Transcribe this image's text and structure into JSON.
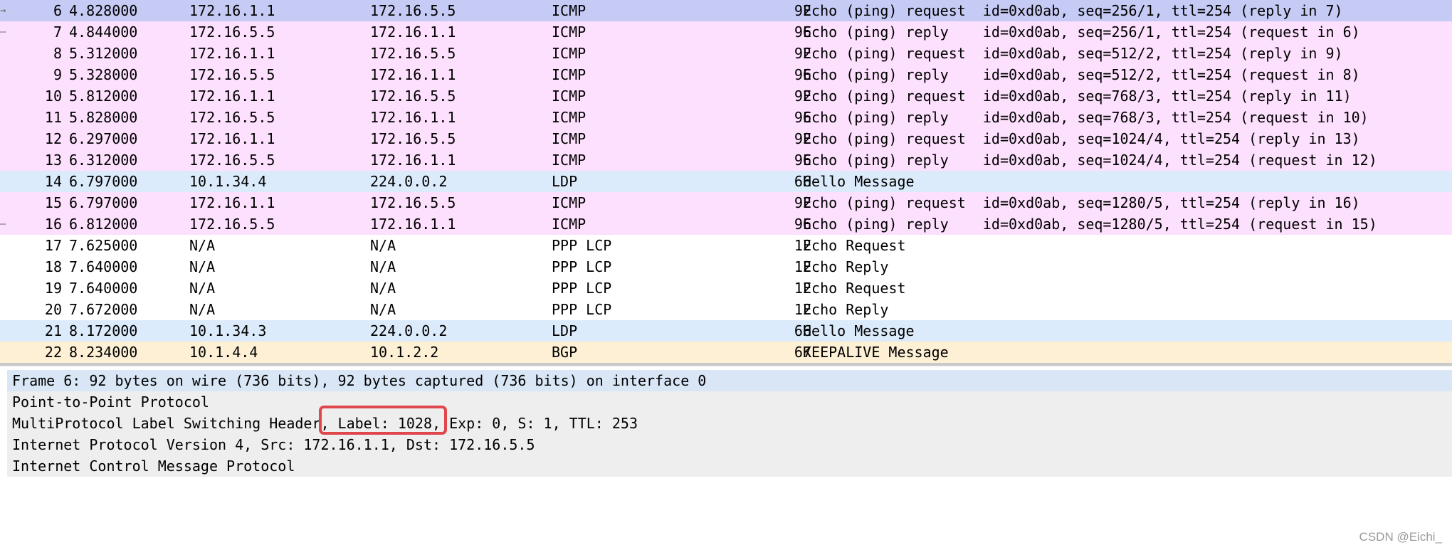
{
  "colors": {
    "selected_row": "#c6cbf5",
    "icmp_row": "#fde0fd",
    "ldp_row": "#dcebfb",
    "ppp_row": "#ffffff",
    "bgp_row": "#fdf0d5",
    "detail_background": "#eeeeee",
    "detail_selected": "#d9e6f5",
    "highlight_border": "#e0474c"
  },
  "packets": [
    {
      "no": "6",
      "time": "4.828000",
      "src": "172.16.1.1",
      "dst": "172.16.5.5",
      "proto": "ICMP",
      "len": "92",
      "info": "Echo (ping) request  id=0xd0ab, seq=256/1, ttl=254 (reply in 7)",
      "row_class": "selected",
      "marker": "→"
    },
    {
      "no": "7",
      "time": "4.844000",
      "src": "172.16.5.5",
      "dst": "172.16.1.1",
      "proto": "ICMP",
      "len": "96",
      "info": "Echo (ping) reply    id=0xd0ab, seq=256/1, ttl=254 (request in 6)",
      "row_class": "icmp",
      "marker": "–"
    },
    {
      "no": "8",
      "time": "5.312000",
      "src": "172.16.1.1",
      "dst": "172.16.5.5",
      "proto": "ICMP",
      "len": "92",
      "info": "Echo (ping) request  id=0xd0ab, seq=512/2, ttl=254 (reply in 9)",
      "row_class": "icmp",
      "marker": ""
    },
    {
      "no": "9",
      "time": "5.328000",
      "src": "172.16.5.5",
      "dst": "172.16.1.1",
      "proto": "ICMP",
      "len": "96",
      "info": "Echo (ping) reply    id=0xd0ab, seq=512/2, ttl=254 (request in 8)",
      "row_class": "icmp",
      "marker": ""
    },
    {
      "no": "10",
      "time": "5.812000",
      "src": "172.16.1.1",
      "dst": "172.16.5.5",
      "proto": "ICMP",
      "len": "92",
      "info": "Echo (ping) request  id=0xd0ab, seq=768/3, ttl=254 (reply in 11)",
      "row_class": "icmp",
      "marker": ""
    },
    {
      "no": "11",
      "time": "5.828000",
      "src": "172.16.5.5",
      "dst": "172.16.1.1",
      "proto": "ICMP",
      "len": "96",
      "info": "Echo (ping) reply    id=0xd0ab, seq=768/3, ttl=254 (request in 10)",
      "row_class": "icmp",
      "marker": ""
    },
    {
      "no": "12",
      "time": "6.297000",
      "src": "172.16.1.1",
      "dst": "172.16.5.5",
      "proto": "ICMP",
      "len": "92",
      "info": "Echo (ping) request  id=0xd0ab, seq=1024/4, ttl=254 (reply in 13)",
      "row_class": "icmp",
      "marker": ""
    },
    {
      "no": "13",
      "time": "6.312000",
      "src": "172.16.5.5",
      "dst": "172.16.1.1",
      "proto": "ICMP",
      "len": "96",
      "info": "Echo (ping) reply    id=0xd0ab, seq=1024/4, ttl=254 (request in 12)",
      "row_class": "icmp",
      "marker": ""
    },
    {
      "no": "14",
      "time": "6.797000",
      "src": "10.1.34.4",
      "dst": "224.0.0.2",
      "proto": "LDP",
      "len": "66",
      "info": "Hello Message",
      "row_class": "ldp",
      "marker": ""
    },
    {
      "no": "15",
      "time": "6.797000",
      "src": "172.16.1.1",
      "dst": "172.16.5.5",
      "proto": "ICMP",
      "len": "92",
      "info": "Echo (ping) request  id=0xd0ab, seq=1280/5, ttl=254 (reply in 16)",
      "row_class": "icmp",
      "marker": ""
    },
    {
      "no": "16",
      "time": "6.812000",
      "src": "172.16.5.5",
      "dst": "172.16.1.1",
      "proto": "ICMP",
      "len": "96",
      "info": "Echo (ping) reply    id=0xd0ab, seq=1280/5, ttl=254 (request in 15)",
      "row_class": "icmp",
      "marker": "–"
    },
    {
      "no": "17",
      "time": "7.625000",
      "src": "N/A",
      "dst": "N/A",
      "proto": "PPP LCP",
      "len": "12",
      "info": "Echo Request",
      "row_class": "ppp",
      "marker": ""
    },
    {
      "no": "18",
      "time": "7.640000",
      "src": "N/A",
      "dst": "N/A",
      "proto": "PPP LCP",
      "len": "12",
      "info": "Echo Reply",
      "row_class": "ppp",
      "marker": ""
    },
    {
      "no": "19",
      "time": "7.640000",
      "src": "N/A",
      "dst": "N/A",
      "proto": "PPP LCP",
      "len": "12",
      "info": "Echo Request",
      "row_class": "ppp",
      "marker": ""
    },
    {
      "no": "20",
      "time": "7.672000",
      "src": "N/A",
      "dst": "N/A",
      "proto": "PPP LCP",
      "len": "12",
      "info": "Echo Reply",
      "row_class": "ppp",
      "marker": ""
    },
    {
      "no": "21",
      "time": "8.172000",
      "src": "10.1.34.3",
      "dst": "224.0.0.2",
      "proto": "LDP",
      "len": "66",
      "info": "Hello Message",
      "row_class": "ldp",
      "marker": ""
    },
    {
      "no": "22",
      "time": "8.234000",
      "src": "10.1.4.4",
      "dst": "10.1.2.2",
      "proto": "BGP",
      "len": "67",
      "info": "KEEPALIVE Message",
      "row_class": "bgp",
      "marker": ""
    }
  ],
  "details": [
    "Frame 6: 92 bytes on wire (736 bits), 92 bytes captured (736 bits) on interface 0",
    "Point-to-Point Protocol",
    "MultiProtocol Label Switching Header, Label: 1028, Exp: 0, S: 1, TTL: 253",
    "Internet Protocol Version 4, Src: 172.16.1.1, Dst: 172.16.5.5",
    "Internet Control Message Protocol"
  ],
  "watermark": "CSDN @Eichi_"
}
